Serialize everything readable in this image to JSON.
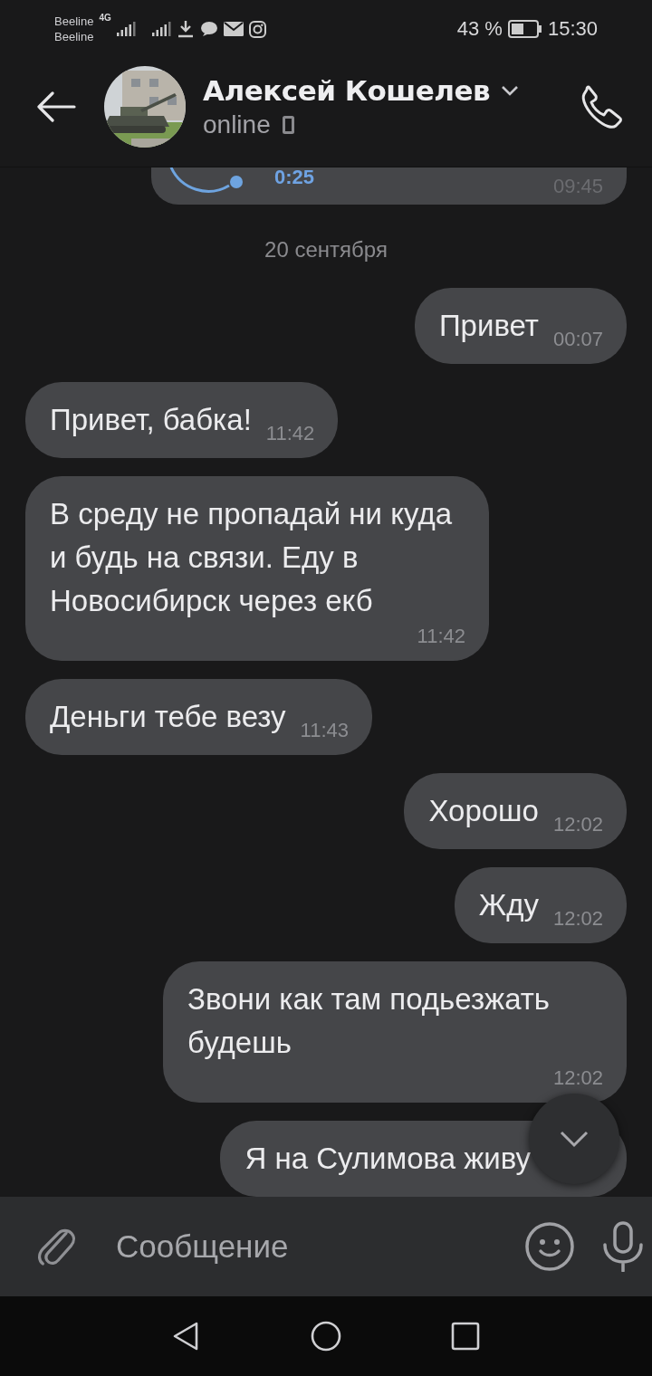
{
  "status_bar": {
    "carrier_1": "Beeline",
    "carrier_2": "Beeline",
    "network": "4G",
    "battery": "43 %",
    "time": "15:30"
  },
  "header": {
    "name": "Алексей Кошелев",
    "status": "online"
  },
  "voice_message": {
    "duration": "0:25",
    "time": "09:45"
  },
  "date_separator": "20 сентября",
  "messages": [
    {
      "kind": "outgoing",
      "text": "Привет",
      "time": "00:07"
    },
    {
      "kind": "incoming",
      "text": "Привет, бабка!",
      "time": "11:42"
    },
    {
      "kind": "incoming",
      "text": "В среду не пропадай ни куда и будь на связи. Еду в Новосибирск через екб",
      "time": "11:42"
    },
    {
      "kind": "incoming",
      "text": "Деньги тебе везу",
      "time": "11:43"
    },
    {
      "kind": "outgoing",
      "text": "Хорошо",
      "time": "12:02"
    },
    {
      "kind": "outgoing",
      "text": "Жду",
      "time": "12:02"
    },
    {
      "kind": "outgoing",
      "text": "Звони как там подьезжать будешь",
      "time": "12:02"
    },
    {
      "kind": "outgoing",
      "text": "Я на Сулимова живу"
    }
  ],
  "composer": {
    "placeholder": "Сообщение"
  }
}
